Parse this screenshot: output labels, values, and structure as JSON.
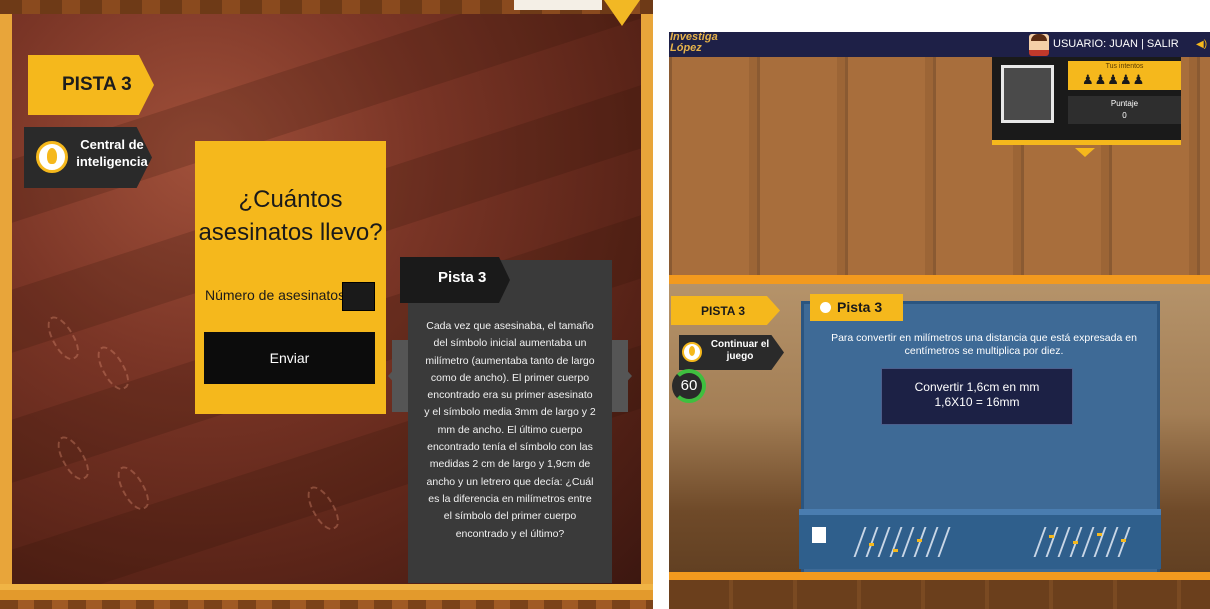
{
  "left_game": {
    "pista_tab": "PISTA 3",
    "central_label": "Central de inteligencia",
    "question": {
      "title": "¿Cuántos asesinatos llevo?",
      "field_label": "Número de asesinatos:",
      "field_value": "",
      "submit": "Enviar"
    },
    "hint": {
      "title": "Pista 3",
      "text": "Cada vez que asesinaba, el tamaño del símbolo inicial aumentaba un milímetro (aumentaba tanto de largo como de ancho). El primer cuerpo encontrado era su primer asesinato y el símbolo media 3mm de largo y 2 mm de ancho. El último cuerpo encontrado tenía el símbolo con las medidas 2 cm de largo y 1,9cm de ancho y un letrero que decía: ¿Cuál es la diferencia en milímetros entre el símbolo del primer cuerpo encontrado y el último?"
    }
  },
  "right_game": {
    "logo": "Investiga López",
    "user_label": "USUARIO: JUAN | SALIR",
    "intentos_label": "Tus intentos",
    "intentos_icons": "♟♟♟♟♟",
    "puntaje_label": "Puntaje",
    "puntaje_value": "0",
    "pista_tab": "PISTA 3",
    "continue_label": "Continuar el juego",
    "timer": "60",
    "board_title": "Pista 3",
    "board_text": "Para convertir en milímetros una distancia que está expresada en centímetros se multiplica por diez.",
    "screen_line1": "Convertir 1,6cm en mm",
    "screen_line2": "1,6X10 = 16mm",
    "sound_icon": "◀)"
  },
  "colors": {
    "accent": "#f5b81c",
    "dark": "#1a1a1a",
    "board_blue": "#3e6a96",
    "navy": "#1e2047"
  }
}
